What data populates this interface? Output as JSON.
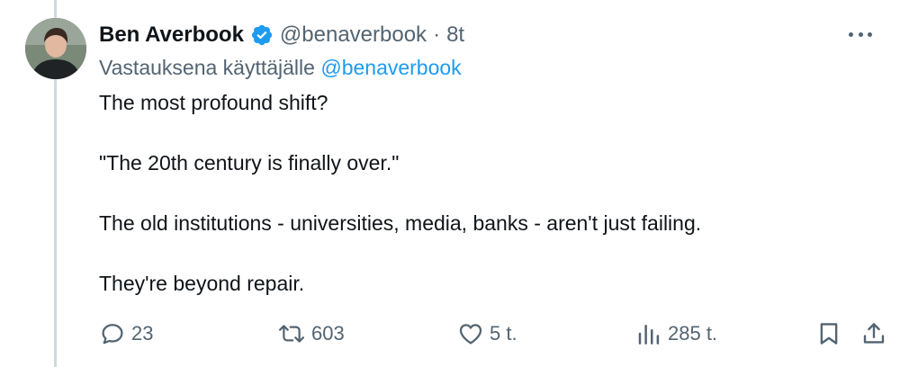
{
  "author": {
    "display_name": "Ben Averbook",
    "handle": "@benaverbook",
    "separator": "·",
    "time": "8t",
    "verified": true,
    "verified_color": "#1d9bf0"
  },
  "reply_context": {
    "prefix": "Vastauksena käyttäjälle",
    "mention": "@benaverbook"
  },
  "body": {
    "paragraphs": [
      "The most profound shift?",
      "\"The 20th century is finally over.\"",
      "The old institutions - universities, media, banks - aren't just failing.",
      "They're beyond repair."
    ]
  },
  "actions": {
    "reply_count": "23",
    "repost_count": "603",
    "like_count": "5 t.",
    "views_count": "285 t."
  },
  "icons": {
    "more": "more-horizontal-icon",
    "reply": "reply-bubble-icon",
    "repost": "repost-icon",
    "like": "heart-icon",
    "views": "views-chart-icon",
    "bookmark": "bookmark-icon",
    "share": "share-icon"
  },
  "colors": {
    "text": "#0f1419",
    "secondary": "#536471",
    "link": "#1d9bf0",
    "thread_line": "#cfd9de"
  }
}
